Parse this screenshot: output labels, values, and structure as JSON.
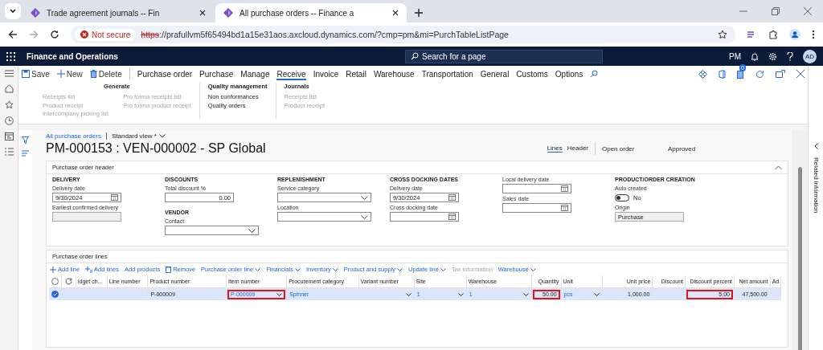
{
  "browser": {
    "tabs": [
      {
        "title": "Trade agreement journals -- Fin",
        "selected": false
      },
      {
        "title": "All purchase orders -- Finance a",
        "selected": true
      }
    ],
    "url": {
      "security": "Not secure",
      "scheme": "https",
      "rest": "://prafullvm5f65494bd1a15e31aos.axcloud.dynamics.com/?cmp=pm&mi=PurchTableListPage"
    }
  },
  "app": {
    "title": "Finance and Operations",
    "search_placeholder": "Search for a page",
    "company": "PM",
    "avatar": "AD"
  },
  "action_pane": {
    "buttons": [
      {
        "label": "Save",
        "kind": "save"
      },
      {
        "label": "New",
        "kind": "new"
      },
      {
        "label": "Delete",
        "kind": "delete"
      }
    ],
    "tabs": [
      {
        "label": "Purchase order",
        "selected": false
      },
      {
        "label": "Purchase",
        "selected": false
      },
      {
        "label": "Manage",
        "selected": false
      },
      {
        "label": "Receive",
        "selected": true
      },
      {
        "label": "Invoice",
        "selected": false
      },
      {
        "label": "Retail",
        "selected": false
      },
      {
        "label": "Warehouse",
        "selected": false
      },
      {
        "label": "Transportation",
        "selected": false
      },
      {
        "label": "General",
        "selected": false
      },
      {
        "label": "Customs",
        "selected": false
      },
      {
        "label": "Options",
        "selected": false
      }
    ],
    "notification_count": "0",
    "groups": [
      {
        "title": "Generate",
        "columns": [
          [
            {
              "label": "Receipts list",
              "disabled": true
            },
            {
              "label": "Product receipt",
              "disabled": true
            },
            {
              "label": "Intercompany picking list",
              "disabled": true
            }
          ],
          [
            {
              "label": "Pro forma receipts list",
              "disabled": true
            },
            {
              "label": "Pro forma product receipt",
              "disabled": true
            }
          ]
        ]
      },
      {
        "title": "Quality management",
        "columns": [
          [
            {
              "label": "Non conformances",
              "disabled": false
            },
            {
              "label": "Quality orders",
              "disabled": false
            }
          ]
        ]
      },
      {
        "title": "Journals",
        "columns": [
          [
            {
              "label": "Receipts list",
              "disabled": true
            },
            {
              "label": "Product receipt",
              "disabled": true
            }
          ]
        ]
      }
    ]
  },
  "breadcrumb": {
    "link": "All purchase orders",
    "view": "Standard view *"
  },
  "title": "PM-000153 : VEN-000002 - SP Global",
  "header_tabs": [
    {
      "label": "Lines",
      "selected": true
    },
    {
      "label": "Header",
      "selected": false
    }
  ],
  "status": [
    "Open order",
    "Approved"
  ],
  "related_panel": "Related information",
  "header_section": {
    "title": "Purchase order header",
    "expanded": true,
    "columns": [
      [
        {
          "heading": "DELIVERY",
          "fields": [
            {
              "label": "Delivery date",
              "kind": "date",
              "value": "9/30/2024"
            },
            {
              "label": "Earliest confirmed delivery",
              "kind": "readonly"
            }
          ]
        }
      ],
      [
        {
          "heading": "DISCOUNTS",
          "fields": [
            {
              "label": "Total discount %",
              "kind": "number",
              "value": "0.00"
            }
          ]
        },
        {
          "heading": "VENDOR",
          "fields": [
            {
              "label": "Contact",
              "kind": "select"
            }
          ]
        }
      ],
      [
        {
          "heading": "REPLENISHMENT",
          "fields": [
            {
              "label": "Service category",
              "kind": "select"
            },
            {
              "label": "Location",
              "kind": "select"
            }
          ]
        }
      ],
      [
        {
          "heading": "CROSS DOCKING DATES",
          "fields": [
            {
              "label": "Delivery date",
              "kind": "date",
              "value": "9/30/2024"
            },
            {
              "label": "Cross docking date",
              "kind": "date"
            }
          ]
        }
      ],
      [
        {
          "fields": [
            {
              "label": "Local delivery date",
              "kind": "date"
            },
            {
              "label": "Sales date",
              "kind": "date"
            }
          ]
        }
      ],
      [
        {
          "heading": "PRODUCT/ORDER CREATION",
          "fields": [
            {
              "label": "Auto created",
              "kind": "toggle",
              "on": false,
              "value": "No"
            },
            {
              "label": "Origin",
              "kind": "readonly",
              "value": "Purchase"
            }
          ]
        }
      ]
    ]
  },
  "lines_section": {
    "title": "Purchase order lines",
    "all_selected": false,
    "toolbar": [
      {
        "label": "Add line",
        "kind": "add",
        "disabled": false
      },
      {
        "label": "Add lines",
        "kind": "addmulti",
        "disabled": false
      },
      {
        "label": "Add products",
        "kind": "plain",
        "disabled": false
      },
      {
        "label": "Remove",
        "kind": "remove",
        "disabled": false
      },
      {
        "label": "Purchase order line",
        "kind": "menu",
        "disabled": false
      },
      {
        "label": "Financials",
        "kind": "menu",
        "disabled": false
      },
      {
        "label": "Inventory",
        "kind": "menu",
        "disabled": false
      },
      {
        "label": "Product and supply",
        "kind": "menu",
        "disabled": false
      },
      {
        "label": "Update line",
        "kind": "menu",
        "disabled": false
      },
      {
        "label": "Tax information",
        "kind": "plain",
        "disabled": true
      },
      {
        "label": "Warehouse",
        "kind": "menu",
        "disabled": false
      }
    ],
    "columns": [
      {
        "label": "idget ch...",
        "kind": "text"
      },
      {
        "label": "Line number",
        "kind": "text"
      },
      {
        "label": "Product number",
        "kind": "text"
      },
      {
        "label": "Item number",
        "kind": "text"
      },
      {
        "label": "Procurement category",
        "kind": "text"
      },
      {
        "label": "Variant number",
        "kind": "text"
      },
      {
        "label": "Site",
        "kind": "text"
      },
      {
        "label": "Warehouse",
        "kind": "text"
      },
      {
        "label": "Quantity",
        "kind": "amount"
      },
      {
        "label": "Unit",
        "kind": "text"
      },
      {
        "label": "Unit price",
        "kind": "amount"
      },
      {
        "label": "Discount",
        "kind": "amount"
      },
      {
        "label": "Discount percent",
        "kind": "amount"
      },
      {
        "label": "Net amount",
        "kind": "amount"
      },
      {
        "label": "Ad",
        "kind": "text"
      }
    ],
    "rows": [
      {
        "selected": true,
        "cells": [
          {
            "link": false,
            "dropdown": false,
            "highlighted": false
          },
          {
            "link": false,
            "dropdown": false,
            "highlighted": false
          },
          {
            "value": "P-000009",
            "link": false,
            "dropdown": false,
            "highlighted": false
          },
          {
            "value": "P-000009",
            "link": true,
            "dropdown": true,
            "highlighted": true
          },
          {
            "value": "Spinner",
            "link": true,
            "dropdown": false,
            "highlighted": false
          },
          {
            "link": false,
            "dropdown": true,
            "highlighted": false
          },
          {
            "value": "1",
            "link": true,
            "dropdown": true,
            "highlighted": false
          },
          {
            "value": "1",
            "link": true,
            "dropdown": true,
            "highlighted": false
          },
          {
            "value": "50.00",
            "link": false,
            "dropdown": false,
            "highlighted": true
          },
          {
            "value": "pcs",
            "link": true,
            "dropdown": true,
            "highlighted": false
          },
          {
            "value": "1,000.00",
            "link": false,
            "dropdown": false,
            "highlighted": false
          },
          {
            "link": false,
            "dropdown": false,
            "highlighted": false
          },
          {
            "value": "5.00",
            "link": false,
            "dropdown": false,
            "highlighted": true
          },
          {
            "value": "47,500.00",
            "link": false,
            "dropdown": false,
            "highlighted": false
          },
          {
            "link": false,
            "dropdown": false,
            "highlighted": false
          }
        ]
      }
    ]
  }
}
